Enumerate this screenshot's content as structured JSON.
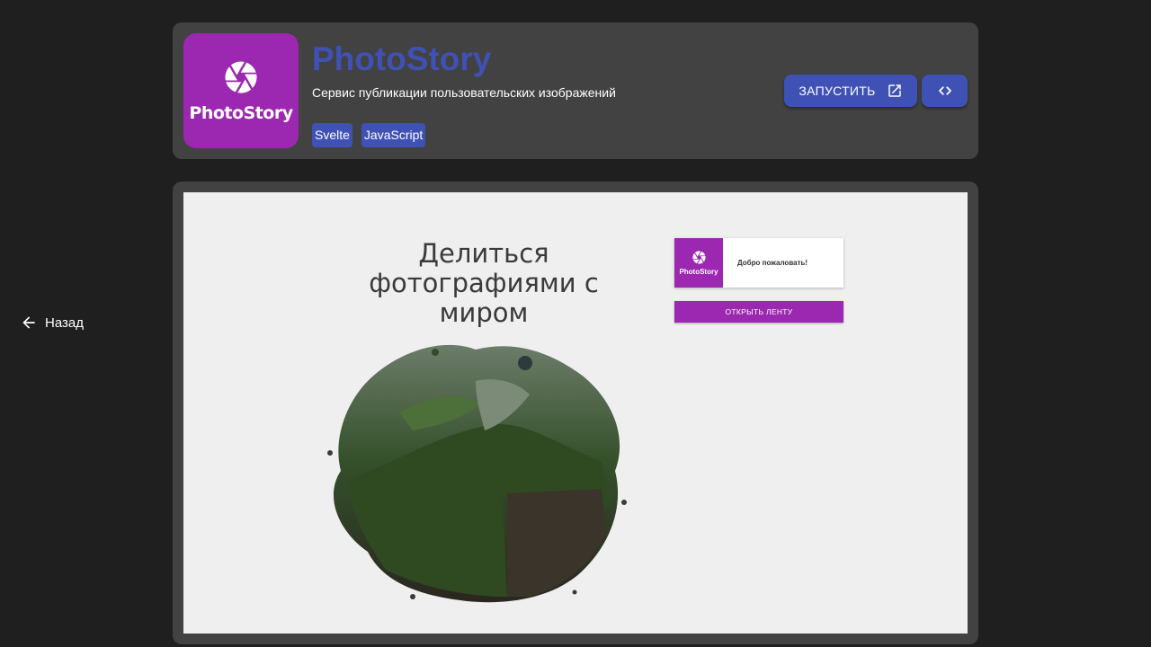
{
  "nav": {
    "back_label": "Назад"
  },
  "project": {
    "logo_text": "PhotoStory",
    "title": "PhotoStory",
    "subtitle": "Сервис публикации пользовательских изображений",
    "tags": [
      "Svelte",
      "JavaScript"
    ],
    "launch_label": "ЗАПУСТИТЬ"
  },
  "preview": {
    "hero_title": "Делиться фотографиями с миром",
    "welcome_logo_text": "PhotoStory",
    "welcome_text": "Добро пожаловать!",
    "open_feed_label": "ОТКРЫТЬ ЛЕНТУ"
  },
  "colors": {
    "page_bg": "#1f1f1f",
    "card_bg": "#424242",
    "accent": "#3f51b5",
    "brand_purple": "#9c27b0"
  },
  "icons": {
    "back": "arrow-left-icon",
    "logo": "camera-aperture-icon",
    "launch": "open-in-new-icon",
    "code": "code-brackets-icon"
  }
}
